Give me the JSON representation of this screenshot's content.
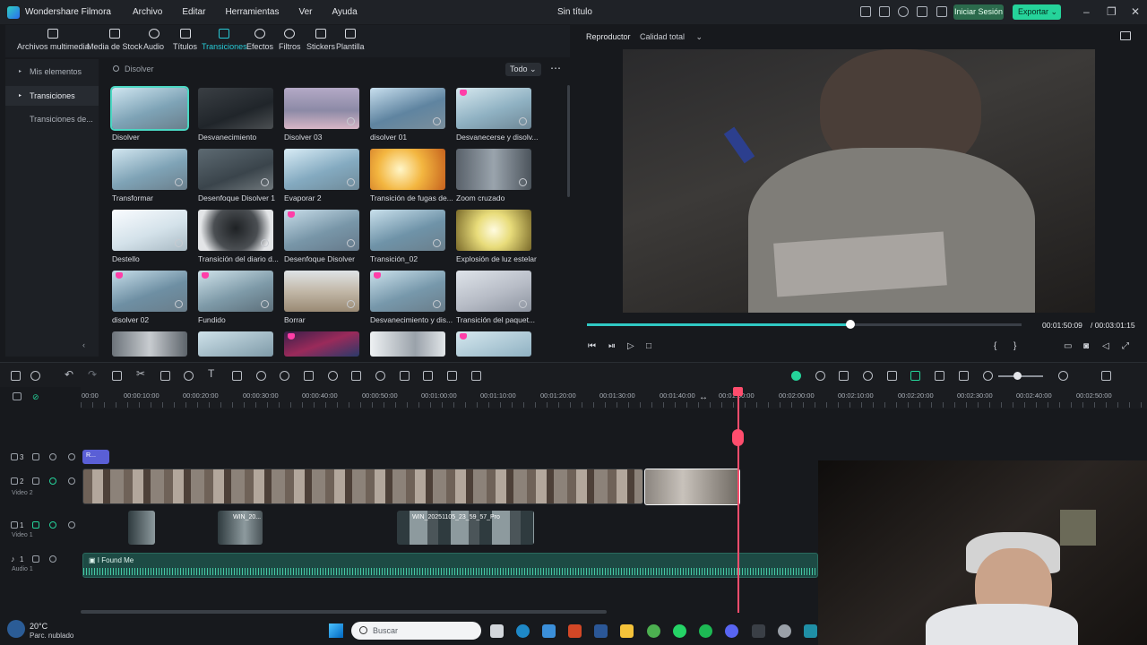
{
  "app": {
    "name": "Wondershare Filmora",
    "doc_title": "Sin título"
  },
  "menu": [
    "Archivo",
    "Editar",
    "Herramientas",
    "Ver",
    "Ayuda"
  ],
  "header_buttons": {
    "signin": "Iniciar Sesión",
    "export": "Exportar"
  },
  "media_tabs": [
    {
      "label": "Archivos multimedia",
      "icon": "media-icon"
    },
    {
      "label": "Media de Stock",
      "icon": "stock-icon"
    },
    {
      "label": "Audio",
      "icon": "music-note-icon"
    },
    {
      "label": "Títulos",
      "icon": "title-text-icon"
    },
    {
      "label": "Transiciones",
      "icon": "transition-icon",
      "active": true
    },
    {
      "label": "Efectos",
      "icon": "sparkle-icon"
    },
    {
      "label": "Filtros",
      "icon": "filter-icon"
    },
    {
      "label": "Stickers",
      "icon": "sticker-icon"
    },
    {
      "label": "Plantilla",
      "icon": "template-icon"
    }
  ],
  "sidebar": [
    {
      "label": "Mis elementos"
    },
    {
      "label": "Transiciones",
      "selected": true
    },
    {
      "label": "Transiciones de..."
    }
  ],
  "search": {
    "query": "Disolver",
    "filter": "Todo"
  },
  "transitions": [
    [
      "Disolver",
      "Desvanecimiento",
      "Disolver 03",
      "disolver 01",
      "Desvanecerse y disolv..."
    ],
    [
      "Transformar",
      "Desenfoque Disolver 1",
      "Evaporar 2",
      "Transición de fugas de...",
      "Zoom cruzado"
    ],
    [
      "Destello",
      "Transición del diario d...",
      "Desenfoque Disolver",
      "Transición_02",
      "Explosión de luz estelar"
    ],
    [
      "disolver 02",
      "Fundido",
      "Borrar",
      "Desvanecimiento y dis...",
      "Transición del paquet..."
    ]
  ],
  "player": {
    "tab": "Reproductor",
    "quality": "Calidad total",
    "current": "00:01:50:09",
    "total": "/ 00:03:01:15",
    "progress": 0.606
  },
  "ruler": [
    "00:00",
    "00:00:10:00",
    "00:00:20:00",
    "00:00:30:00",
    "00:00:40:00",
    "00:00:50:00",
    "00:01:00:00",
    "00:01:10:00",
    "00:01:20:00",
    "00:01:30:00",
    "00:01:40:00",
    "00:01:50:00",
    "00:02:00:00",
    "00:02:10:00",
    "00:02:20:00",
    "00:02:30:00",
    "00:02:40:00",
    "00:02:50:00"
  ],
  "tracks": [
    {
      "num": "3",
      "name": "",
      "clip": "R..."
    },
    {
      "num": "2",
      "name": "Video 2"
    },
    {
      "num": "1",
      "name": "Video 1",
      "clip_labels": [
        "WIN_20...",
        "WIN_20251105_23_59_57_Pro"
      ]
    },
    {
      "num": "1",
      "name": "Audio 1",
      "clip": "I Found Me"
    }
  ],
  "taskbar": {
    "temp": "20°C",
    "weather": "Parc. nublado",
    "search": "Buscar"
  }
}
